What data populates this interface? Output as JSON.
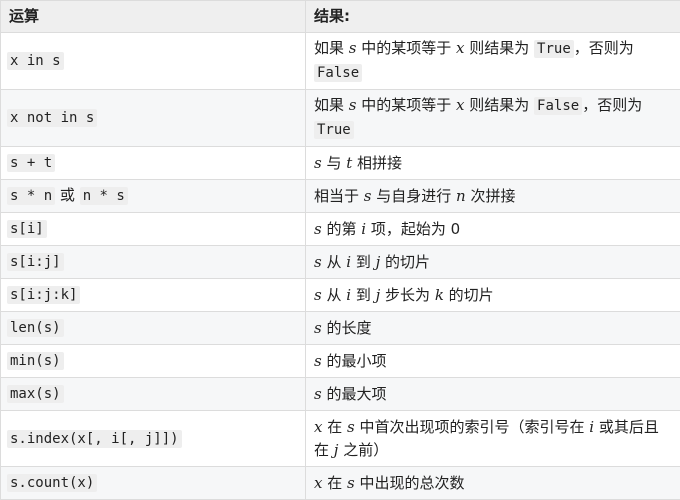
{
  "header": {
    "col1": "运算",
    "col2": "结果:"
  },
  "rows": [
    {
      "op": "x in s",
      "desc": [
        "如果 ",
        "s",
        " 中的某项等于 ",
        "x",
        " 则结果为 ",
        "True",
        "，否则为 ",
        "False"
      ]
    },
    {
      "op": "x not in s",
      "desc": [
        "如果 ",
        "s",
        " 中的某项等于 ",
        "x",
        " 则结果为 ",
        "False",
        "，否则为 ",
        "True"
      ]
    },
    {
      "op": "s + t",
      "desc": [
        "s",
        " 与 ",
        "t",
        " 相拼接"
      ]
    },
    {
      "op_a": "s * n",
      "op_or": " 或 ",
      "op_b": "n * s",
      "desc": [
        "相当于 ",
        "s",
        " 与自身进行 ",
        "n",
        " 次拼接"
      ]
    },
    {
      "op": "s[i]",
      "desc": [
        "s",
        " 的第 ",
        "i",
        " 项，起始为 0"
      ]
    },
    {
      "op": "s[i:j]",
      "desc": [
        "s",
        " 从 ",
        "i",
        " 到 ",
        "j",
        " 的切片"
      ]
    },
    {
      "op": "s[i:j:k]",
      "desc": [
        "s",
        " 从 ",
        "i",
        " 到 ",
        "j",
        " 步长为 ",
        "k",
        " 的切片"
      ]
    },
    {
      "op": "len(s)",
      "desc": [
        "s",
        " 的长度"
      ]
    },
    {
      "op": "min(s)",
      "desc": [
        "s",
        " 的最小项"
      ]
    },
    {
      "op": "max(s)",
      "desc": [
        "s",
        " 的最大项"
      ]
    },
    {
      "op": "s.index(x[, i[, j]])",
      "desc": [
        "x",
        " 在 ",
        "s",
        " 中首次出现项的索引号（索引号在 ",
        "i",
        " 或其后且在 ",
        "j",
        " 之前）"
      ]
    },
    {
      "op": "s.count(x)",
      "desc": [
        "x",
        " 在 ",
        "s",
        " 中出现的总次数"
      ]
    }
  ]
}
